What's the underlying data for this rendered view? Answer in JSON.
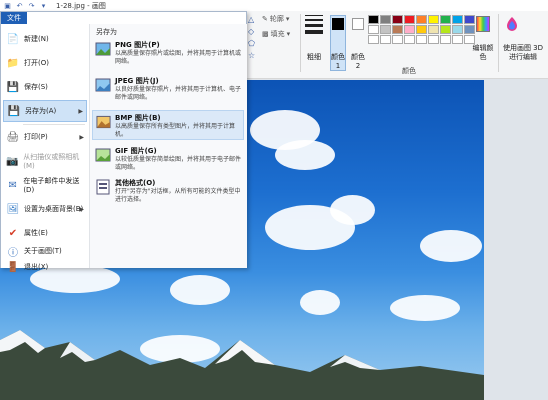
{
  "window": {
    "title": "1-28.jpg - 画图"
  },
  "ribbon": {
    "file_tab": "文件",
    "outline_label": "轮廓",
    "fill_label": "填充",
    "thickness_label": "粗细",
    "color1_label": "颜色 1",
    "color2_label": "颜色 2",
    "colors_group_label": "颜色",
    "edit_colors_label": "编辑颜色",
    "paint3d_label": "使用画图 3D 进行编辑",
    "palette": [
      "#000000",
      "#7f7f7f",
      "#880015",
      "#ed1c24",
      "#ff7f27",
      "#fff200",
      "#22b14c",
      "#00a2e8",
      "#3f48cc",
      "#ffffff",
      "#c3c3c3",
      "#b97a57",
      "#ffaec9",
      "#ffc90e",
      "#efe4b0",
      "#b5e61d",
      "#99d9ea",
      "#7092be",
      "#ffffff",
      "#ffffff",
      "#ffffff",
      "#ffffff",
      "#ffffff",
      "#ffffff",
      "#ffffff",
      "#ffffff",
      "#ffffff"
    ]
  },
  "menu": {
    "header": "文件",
    "items": [
      {
        "label": "新建(N)"
      },
      {
        "label": "打开(O)"
      },
      {
        "label": "保存(S)"
      },
      {
        "label": "另存为(A)"
      },
      {
        "label": "打印(P)"
      },
      {
        "label": "从扫描仪或照相机(M)"
      },
      {
        "label": "在电子邮件中发送(D)"
      },
      {
        "label": "设置为桌面背景(B)"
      },
      {
        "label": "属性(E)"
      },
      {
        "label": "关于画图(T)"
      },
      {
        "label": "退出(X)"
      }
    ],
    "save_as_header": "另存为",
    "save_as": [
      {
        "name": "PNG 图片(P)",
        "desc": "以高质量保存照片或绘图，并将其用于计算机或网络。"
      },
      {
        "name": "JPEG 图片(J)",
        "desc": "以良好质量保存照片，并将其用于计算机、电子邮件或网络。"
      },
      {
        "name": "BMP 图片(B)",
        "desc": "以高质量保存所有类型图片，并将其用于计算机。"
      },
      {
        "name": "GIF 图片(G)",
        "desc": "以较低质量保存简单绘图，并将其用于电子邮件或网络。"
      },
      {
        "name": "其他格式(O)",
        "desc": "打开\"另存为\"对话框，从所有可能的文件类型中进行选择。"
      }
    ]
  }
}
